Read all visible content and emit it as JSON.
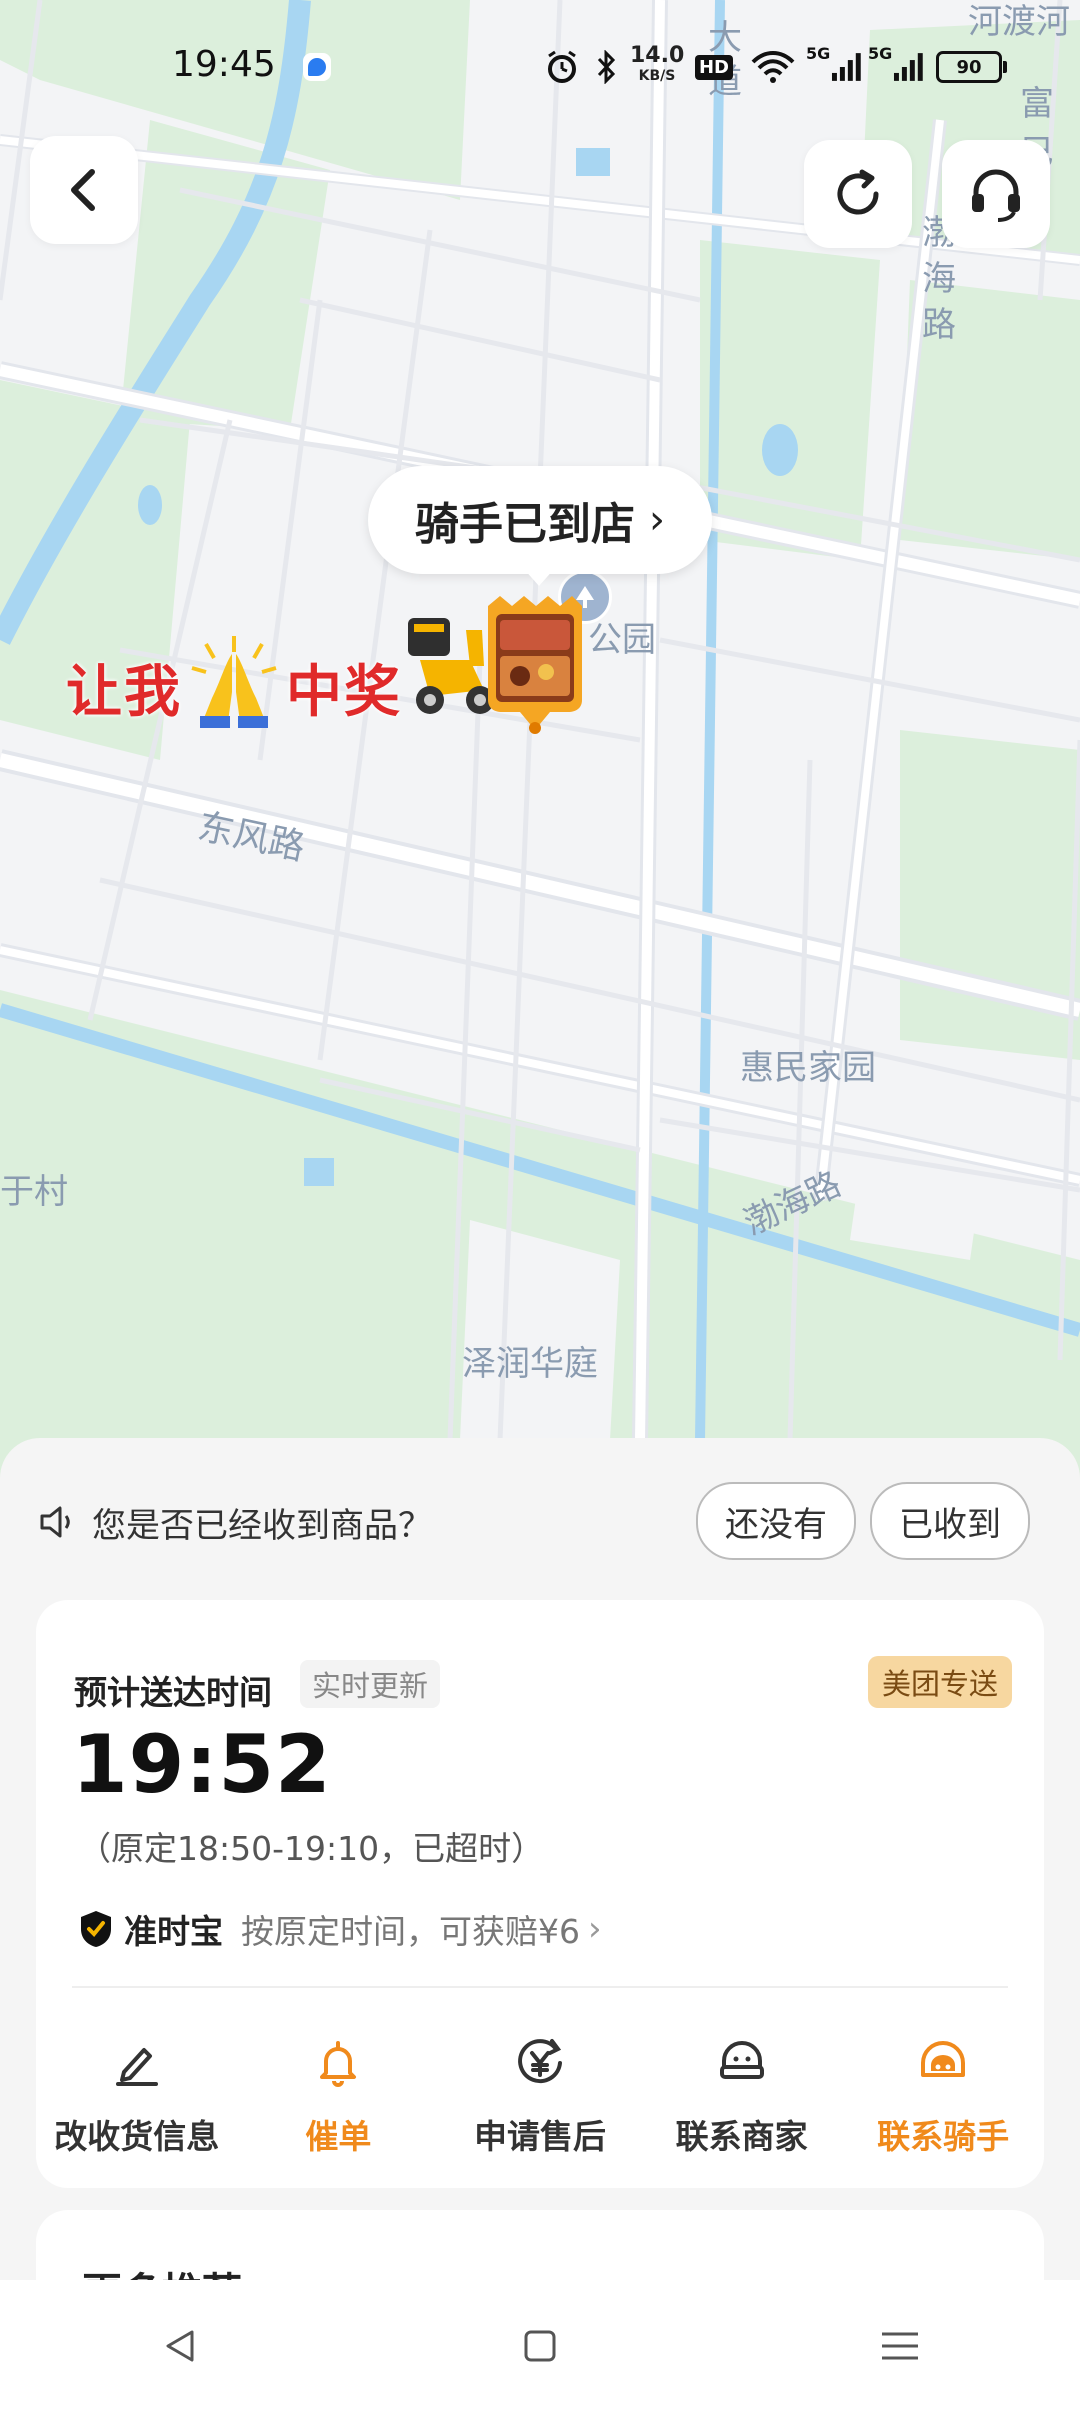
{
  "status_bar": {
    "time": "19:45",
    "net_speed": "14.0",
    "net_unit": "KB/S",
    "hd_label": "HD",
    "signal1_label": "5G",
    "signal2_label": "5G",
    "battery": "90"
  },
  "map": {
    "rider_bubble": "骑手已到店",
    "lottery_left": "让我",
    "lottery_right": "中奖",
    "labels": {
      "park": "公园",
      "dongfeng_road": "东风路",
      "huimin": "惠民家园",
      "bohai_road_bottom": "渤海路",
      "bohai_road_top": "渤海路",
      "yu_village": "于村",
      "zerun": "泽润华庭",
      "da_dao": "大道",
      "fu_top": "富巳",
      "top_right_partial": "河渡河"
    }
  },
  "receipt_prompt": {
    "question": "您是否已经收到商品？",
    "not_yet": "还没有",
    "received": "已收到"
  },
  "delivery_card": {
    "eta_title": "预计送达时间",
    "eta_tag": "实时更新",
    "brand_badge": "美团专送",
    "eta_time": "19:52",
    "original_time": "（原定18:50-19:10，已超时）",
    "ontime_name": "准时宝",
    "ontime_desc": "按原定时间，可获赔¥6",
    "actions": [
      {
        "label": "改收货信息",
        "icon": "pencil-icon",
        "accent": false
      },
      {
        "label": "催单",
        "icon": "bell-icon",
        "accent": true
      },
      {
        "label": "申请售后",
        "icon": "yuan-refund-icon",
        "accent": false
      },
      {
        "label": "联系商家",
        "icon": "merchant-icon",
        "accent": false
      },
      {
        "label": "联系骑手",
        "icon": "rider-helmet-icon",
        "accent": true
      }
    ]
  },
  "more_section": {
    "title": "更多推荐"
  },
  "colors": {
    "accent": "#f08a1c",
    "map_green": "#d9efd9",
    "map_road": "#ffffff",
    "water": "#9fd0f0",
    "lottery_red": "#e02a2a"
  }
}
